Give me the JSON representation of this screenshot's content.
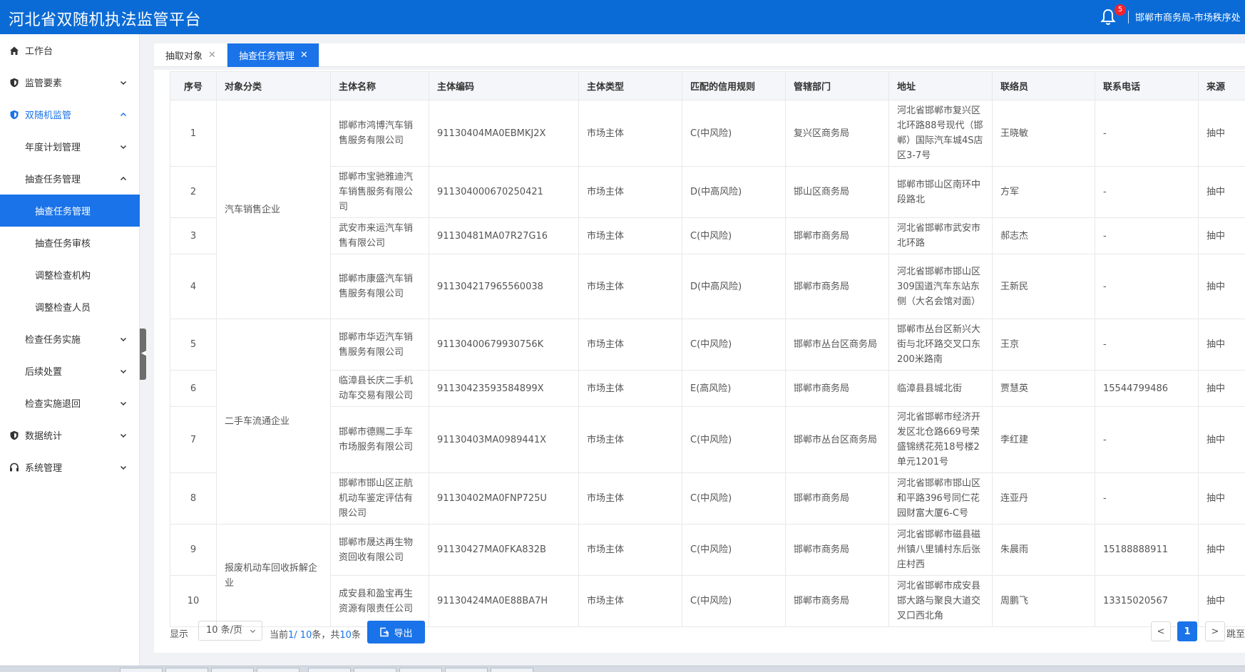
{
  "header": {
    "title": "河北省双随机执法监管平台",
    "notification_count": "5",
    "user": "邯郸市商务局-市场秩序处"
  },
  "sidebar": {
    "items": [
      {
        "label": "工作台",
        "icon": "home-icon"
      },
      {
        "label": "监管要素",
        "icon": "shield-icon"
      },
      {
        "label": "双随机监管",
        "icon": "shield-icon"
      },
      {
        "label": "年度计划管理"
      },
      {
        "label": "抽查任务管理"
      },
      {
        "label": "抽查任务管理"
      },
      {
        "label": "抽查任务审核"
      },
      {
        "label": "调整检查机构"
      },
      {
        "label": "调整检查人员"
      },
      {
        "label": "检查任务实施"
      },
      {
        "label": "后续处置"
      },
      {
        "label": "检查实施退回"
      },
      {
        "label": "数据统计",
        "icon": "shield-icon"
      },
      {
        "label": "系统管理",
        "icon": "headset-icon"
      }
    ]
  },
  "tabs": [
    {
      "label": "抽取对象"
    },
    {
      "label": "抽查任务管理"
    }
  ],
  "table": {
    "columns": [
      "序号",
      "对象分类",
      "主体名称",
      "主体编码",
      "主体类型",
      "匹配的信用规则",
      "管辖部门",
      "地址",
      "联络员",
      "联系电话",
      "来源"
    ],
    "groups": [
      "汽车销售企业",
      "二手车流通企业",
      "报废机动车回收拆解企业"
    ],
    "rows": [
      {
        "no": "1",
        "name": "邯郸市鸿博汽车销售服务有限公司",
        "code": "91130404MA0EBMKJ2X",
        "type": "市场主体",
        "rule": "C(中风险)",
        "dept": "复兴区商务局",
        "addr": "河北省邯郸市复兴区北环路88号现代（邯郸）国际汽车城4S店区3-7号",
        "contact": "王晓敏",
        "phone": "-",
        "source": "抽中"
      },
      {
        "no": "2",
        "name": "邯郸市宝驰雅迪汽车销售服务有限公司",
        "code": "911304000670250421",
        "type": "市场主体",
        "rule": "D(中高风险)",
        "dept": "邯山区商务局",
        "addr": "邯郸市邯山区南环中段路北",
        "contact": "方军",
        "phone": "-",
        "source": "抽中"
      },
      {
        "no": "3",
        "name": "武安市来运汽车销售有限公司",
        "code": "91130481MA07R27G16",
        "type": "市场主体",
        "rule": "C(中风险)",
        "dept": "邯郸市商务局",
        "addr": "河北省邯郸市武安市北环路",
        "contact": "郝志杰",
        "phone": "-",
        "source": "抽中"
      },
      {
        "no": "4",
        "name": "邯郸市康盛汽车销售服务有限公司",
        "code": "911304217965560038",
        "type": "市场主体",
        "rule": "D(中高风险)",
        "dept": "邯郸市商务局",
        "addr": "河北省邯郸市邯山区309国道汽车东站东侧（大名会馆对面）",
        "contact": "王新民",
        "phone": "-",
        "source": "抽中"
      },
      {
        "no": "5",
        "name": "邯郸市华迈汽车销售服务有限公司",
        "code": "91130400679930756K",
        "type": "市场主体",
        "rule": "C(中风险)",
        "dept": "邯郸市丛台区商务局",
        "addr": "邯郸市丛台区新兴大街与北环路交叉口东200米路南",
        "contact": "王京",
        "phone": "-",
        "source": "抽中"
      },
      {
        "no": "6",
        "name": "临漳县长庆二手机动车交易有限公司",
        "code": "91130423593584899X",
        "type": "市场主体",
        "rule": "E(高风险)",
        "dept": "邯郸市商务局",
        "addr": "临漳县县城北街",
        "contact": "贾慧英",
        "phone": "15544799486",
        "source": "抽中"
      },
      {
        "no": "7",
        "name": "邯郸市德赐二手车市场服务有限公司",
        "code": "91130403MA0989441X",
        "type": "市场主体",
        "rule": "C(中风险)",
        "dept": "邯郸市丛台区商务局",
        "addr": "河北省邯郸市经济开发区北仓路669号荣盛锦绣花苑18号楼2单元1201号",
        "contact": "李红建",
        "phone": "-",
        "source": "抽中"
      },
      {
        "no": "8",
        "name": "邯郸市邯山区正航机动车鉴定评估有限公司",
        "code": "91130402MA0FNP725U",
        "type": "市场主体",
        "rule": "C(中风险)",
        "dept": "邯郸市商务局",
        "addr": "河北省邯郸市邯山区和平路396号同仁花园财富大厦6-C号",
        "contact": "连亚丹",
        "phone": "-",
        "source": "抽中"
      },
      {
        "no": "9",
        "name": "邯郸市晟达再生物资回收有限公司",
        "code": "91130427MA0FKA832B",
        "type": "市场主体",
        "rule": "C(中风险)",
        "dept": "邯郸市商务局",
        "addr": "河北省邯郸市磁县磁州镇八里铺村东后张庄村西",
        "contact": "朱晨雨",
        "phone": "15188888911",
        "source": "抽中"
      },
      {
        "no": "10",
        "name": "成安县和盈宝再生资源有限责任公司",
        "code": "91130424MA0E88BA7H",
        "type": "市场主体",
        "rule": "C(中风险)",
        "dept": "邯郸市商务局",
        "addr": "河北省邯郸市成安县邯大路与聚良大道交叉口西北角",
        "contact": "周鹏飞",
        "phone": "13315020567",
        "source": "抽中"
      }
    ]
  },
  "pagination": {
    "show_label": "显示",
    "page_size": "10 条/页",
    "info_prefix": "当前",
    "info_range": "1/ 10",
    "info_mid": "条，共",
    "info_total": "10",
    "info_suffix": "条",
    "export_label": "导出",
    "current_page": "1",
    "prev": "<",
    "next": ">",
    "jump_label": "跳至"
  },
  "colors": {
    "header_bg": "#0a6bd6",
    "accent": "#1a73e8",
    "badge": "#f5222d"
  }
}
